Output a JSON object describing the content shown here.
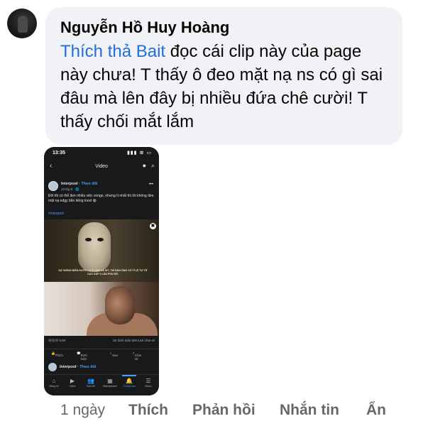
{
  "comment": {
    "author": "Nguyễn Hồ Huy Hoàng",
    "mention": "Thích thả Bait",
    "text": " đọc cái clip này của page này chưa! T thấy ô đeo mặt nạ ns có gì sai đâu mà lên đây bị nhiều đứa chê cười! T thấy chối mắt lắm"
  },
  "screenshot": {
    "status_time": "13:35",
    "status_icons": "▮▮▮ ≋ ▭",
    "header_title": "Video",
    "post": {
      "page_name": "Interpool",
      "follow": "Theo dõi",
      "date": "23 thg 8 · 🌐",
      "text": "Đôi tôi có thể làm nhiều việc cringe, nhưng ít nhất thì tôi không đeo mặt nạ edgy bắn tiếng incel 😆",
      "hashtag": "#interpool",
      "subtitle": "SỰ GIỐNG BIẾN NƯỚC LÀ Ở ANH VÀ MÝ, THỈ ĐÀN ÔNG CÓ TỈ LỆ TỰ TỬ CAO GẤP 3 LẦN PHỤ NỮ.",
      "reactions": "😆😮😢 9,9K",
      "comments_shares": "2K bình luận   826 lượt chia sẻ",
      "actions": [
        "Thích",
        "Bình luận",
        "Sao",
        "Chia sẻ"
      ]
    },
    "next_post": {
      "page_name": "Interpool",
      "follow": "Theo dõi"
    },
    "tabs": [
      {
        "label": "Bảng tin",
        "glyph": "⌂"
      },
      {
        "label": "Video",
        "glyph": "▶"
      },
      {
        "label": "Bạn bè",
        "glyph": "👥"
      },
      {
        "label": "Marketplace",
        "glyph": "▦"
      },
      {
        "label": "Thông báo",
        "glyph": "🔔"
      },
      {
        "label": "Menu",
        "glyph": "☰"
      }
    ]
  },
  "footer": {
    "time": "1 ngày",
    "like": "Thích",
    "reply": "Phản hồi",
    "message": "Nhắn tin",
    "hide": "Ẩn"
  }
}
